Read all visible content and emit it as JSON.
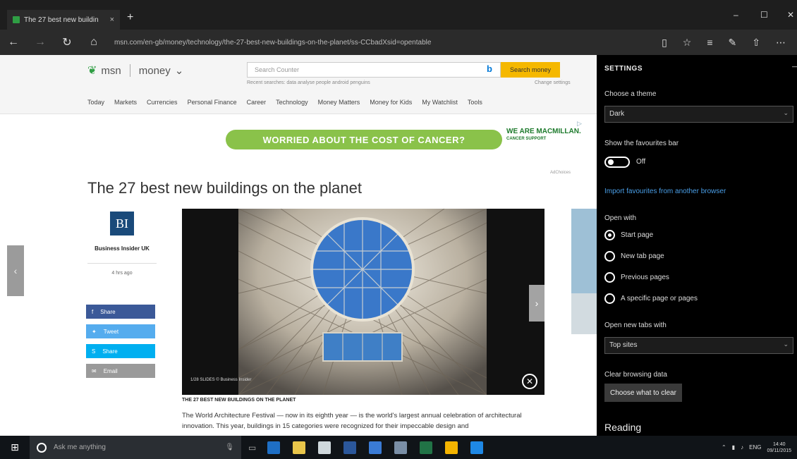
{
  "browser": {
    "tab_title": "The 27 best new buildin",
    "tab_close": "×",
    "new_tab": "+",
    "url": "msn.com/en-gb/money/technology/the-27-best-new-buildings-on-the-planet/ss-CCbadXsid=opentable",
    "nav": {
      "back": "←",
      "forward": "→",
      "refresh": "↻",
      "home": "⌂"
    },
    "window_controls": {
      "minimize": "–",
      "maximize": "☐",
      "close": "✕"
    },
    "toolbar_icons": [
      "reading-view-icon",
      "favorite-star-icon",
      "hub-icon",
      "web-note-icon",
      "share-icon",
      "more-icon"
    ]
  },
  "msn": {
    "brand": "msn",
    "section": "money",
    "section_chevron": "⌄",
    "search_placeholder": "Search Counter",
    "search_button": "Search money",
    "trending": "Recent searches: data  analyse  people  android  penguins",
    "change_link": "Change settings",
    "nav": [
      "Today",
      "Markets",
      "Currencies",
      "Personal Finance",
      "Career",
      "Technology",
      "Money Matters",
      "Money for Kids",
      "My Watchlist",
      "Tools"
    ]
  },
  "ad": {
    "text": "WORRIED ABOUT THE COST OF CANCER?",
    "brand": "WE ARE MACMILLAN.",
    "brand_sub": "CANCER SUPPORT",
    "caption": "AdChoices"
  },
  "article": {
    "headline": "The 27 best new buildings on the planet",
    "source_logo": "BI",
    "source_name": "Business Insider UK",
    "age": "4 hrs ago",
    "share": {
      "facebook": "Share",
      "twitter": "Tweet",
      "skype": "Share",
      "email": "Email"
    },
    "slide_caption": "1/28 SLIDES  © Business Insider",
    "slide_title": "THE 27 BEST NEW BUILDINGS ON THE PLANET",
    "body": "The World Architecture Festival — now in its eighth year — is the world's largest annual celebration of architectural innovation. This year, buildings in 15 categories were recognized for their impeccable design and"
  },
  "settings": {
    "title": "SETTINGS",
    "theme_label": "Choose a theme",
    "theme_value": "Dark",
    "favbar_label": "Show the favourites bar",
    "favbar_state": "Off",
    "import_link": "Import favourites from another browser",
    "open_with_label": "Open with",
    "open_with_options": [
      "Start page",
      "New tab page",
      "Previous pages",
      "A specific page or pages"
    ],
    "open_with_selected": 0,
    "newtab_label": "Open new tabs with",
    "newtab_value": "Top sites",
    "clear_label": "Clear browsing data",
    "clear_button": "Choose what to clear",
    "reading_heading": "Reading"
  },
  "taskbar": {
    "search_placeholder": "Ask me anything",
    "apps": [
      "edge",
      "file-explorer",
      "store",
      "word",
      "settings",
      "photos",
      "excel",
      "drive",
      "ie"
    ],
    "app_colors": [
      "#1e6fc5",
      "#e8c54a",
      "#cfd8dc",
      "#2b579a",
      "#3a7bd5",
      "#7a8fa6",
      "#217346",
      "#f4b400",
      "#1e88e5"
    ],
    "language": "ENG",
    "time": "14:40",
    "date": "09/11/2015"
  }
}
